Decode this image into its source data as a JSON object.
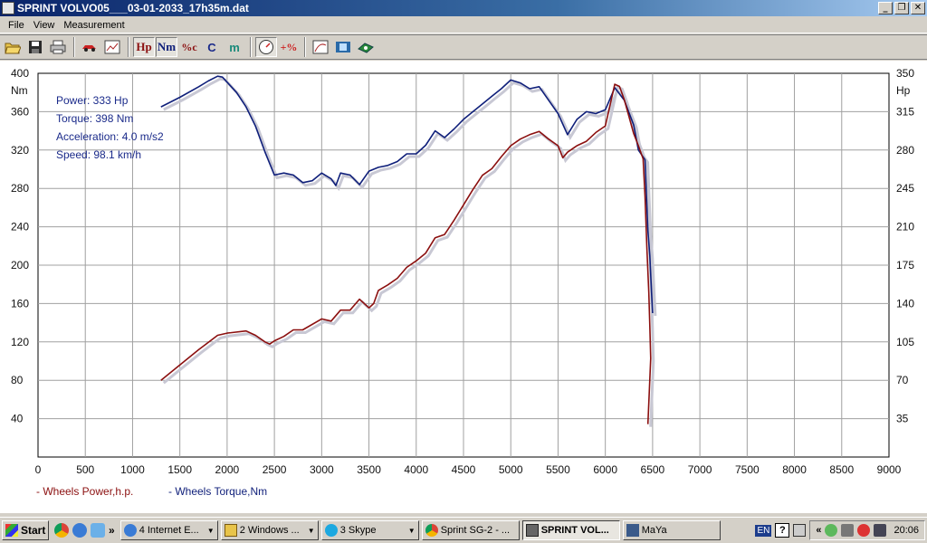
{
  "window": {
    "title": "SPRINT VOLVO05___03-01-2033_17h35m.dat",
    "min": "_",
    "max": "❐",
    "close": "✕"
  },
  "menu": [
    {
      "label": "File"
    },
    {
      "label": "View"
    },
    {
      "label": "Measurement"
    }
  ],
  "toolbar": {
    "hp": "Hp",
    "nm": "Nm",
    "pct": "%c",
    "c": "C",
    "m": "m",
    "plus_pct": "+%"
  },
  "info": {
    "power": "Power: 333 Hp",
    "torque": "Torque: 398 Nm",
    "acceleration": "Acceleration: 4.0 m/s2",
    "speed": "Speed: 98.1 km/h"
  },
  "legend": {
    "power": "- Wheels Power,h.p.",
    "torque": "- Wheels Torque,Nm"
  },
  "colors": {
    "power": "#8b0f0f",
    "torque": "#0f1f7a",
    "info": "#1a2a8a",
    "shadow": "#c8c8d4"
  },
  "chart_data": {
    "type": "line",
    "xlim": [
      0,
      9000
    ],
    "x_ticks": [
      "0",
      "500",
      "1000",
      "1500",
      "2000",
      "2500",
      "3000",
      "3500",
      "4000",
      "4500",
      "5000",
      "5500",
      "6000",
      "6500",
      "7000",
      "7500",
      "8000",
      "8500",
      "9000"
    ],
    "ylim_left": [
      0,
      400
    ],
    "y_left_unit": "Nm",
    "y_left_ticks": [
      "400",
      "360",
      "320",
      "280",
      "240",
      "200",
      "160",
      "120",
      "80",
      "40"
    ],
    "ylim_right": [
      0,
      350
    ],
    "y_right_unit": "Hp",
    "y_right_ticks": [
      "350",
      "315",
      "280",
      "245",
      "210",
      "175",
      "140",
      "105",
      "70",
      "35"
    ],
    "series": [
      {
        "name": "Wheels Torque,Nm",
        "axis": "left",
        "points": [
          [
            1300,
            365
          ],
          [
            1500,
            375
          ],
          [
            1700,
            386
          ],
          [
            1800,
            392
          ],
          [
            1900,
            397
          ],
          [
            1950,
            396
          ],
          [
            2100,
            380
          ],
          [
            2200,
            365
          ],
          [
            2300,
            345
          ],
          [
            2400,
            318
          ],
          [
            2500,
            294
          ],
          [
            2600,
            296
          ],
          [
            2700,
            294
          ],
          [
            2800,
            286
          ],
          [
            2900,
            288
          ],
          [
            3000,
            296
          ],
          [
            3100,
            290
          ],
          [
            3150,
            283
          ],
          [
            3200,
            296
          ],
          [
            3300,
            294
          ],
          [
            3400,
            284
          ],
          [
            3500,
            298
          ],
          [
            3600,
            302
          ],
          [
            3700,
            304
          ],
          [
            3800,
            308
          ],
          [
            3900,
            316
          ],
          [
            4000,
            316
          ],
          [
            4100,
            325
          ],
          [
            4200,
            340
          ],
          [
            4300,
            333
          ],
          [
            4400,
            342
          ],
          [
            4500,
            352
          ],
          [
            4600,
            360
          ],
          [
            4700,
            368
          ],
          [
            4800,
            376
          ],
          [
            4900,
            384
          ],
          [
            5000,
            393
          ],
          [
            5100,
            390
          ],
          [
            5200,
            384
          ],
          [
            5300,
            386
          ],
          [
            5400,
            372
          ],
          [
            5500,
            358
          ],
          [
            5600,
            336
          ],
          [
            5700,
            352
          ],
          [
            5800,
            360
          ],
          [
            5900,
            358
          ],
          [
            6000,
            362
          ],
          [
            6100,
            385
          ],
          [
            6200,
            372
          ],
          [
            6300,
            346
          ],
          [
            6350,
            320
          ],
          [
            6420,
            310
          ],
          [
            6450,
            236
          ],
          [
            6470,
            210
          ],
          [
            6490,
            170
          ],
          [
            6500,
            150
          ]
        ]
      },
      {
        "name": "Wheels Power,h.p.",
        "axis": "right",
        "points": [
          [
            1300,
            70
          ],
          [
            1500,
            84
          ],
          [
            1700,
            98
          ],
          [
            1900,
            111
          ],
          [
            2000,
            113
          ],
          [
            2200,
            115
          ],
          [
            2300,
            111
          ],
          [
            2400,
            105
          ],
          [
            2450,
            103
          ],
          [
            2500,
            106
          ],
          [
            2600,
            110
          ],
          [
            2700,
            116
          ],
          [
            2800,
            116
          ],
          [
            3000,
            126
          ],
          [
            3100,
            124
          ],
          [
            3200,
            134
          ],
          [
            3300,
            134
          ],
          [
            3400,
            144
          ],
          [
            3500,
            136
          ],
          [
            3550,
            140
          ],
          [
            3600,
            152
          ],
          [
            3700,
            157
          ],
          [
            3800,
            163
          ],
          [
            3900,
            173
          ],
          [
            4000,
            179
          ],
          [
            4100,
            186
          ],
          [
            4200,
            200
          ],
          [
            4300,
            203
          ],
          [
            4400,
            216
          ],
          [
            4500,
            230
          ],
          [
            4600,
            244
          ],
          [
            4700,
            257
          ],
          [
            4800,
            263
          ],
          [
            4900,
            274
          ],
          [
            5000,
            284
          ],
          [
            5100,
            290
          ],
          [
            5200,
            294
          ],
          [
            5300,
            297
          ],
          [
            5400,
            290
          ],
          [
            5500,
            284
          ],
          [
            5550,
            273
          ],
          [
            5600,
            278
          ],
          [
            5700,
            284
          ],
          [
            5800,
            288
          ],
          [
            5900,
            296
          ],
          [
            6000,
            302
          ],
          [
            6100,
            340
          ],
          [
            6150,
            338
          ],
          [
            6200,
            326
          ],
          [
            6300,
            295
          ],
          [
            6350,
            284
          ],
          [
            6400,
            272
          ],
          [
            6420,
            238
          ],
          [
            6440,
            190
          ],
          [
            6460,
            150
          ],
          [
            6470,
            120
          ],
          [
            6480,
            90
          ],
          [
            6450,
            30
          ]
        ]
      }
    ]
  },
  "taskbar": {
    "start": "Start",
    "more": "»",
    "items": [
      {
        "label": "4 Internet E...",
        "icon": "ie-icon"
      },
      {
        "label": "2 Windows ...",
        "icon": "folder-icon"
      },
      {
        "label": "3 Skype",
        "icon": "skype-icon"
      },
      {
        "label": "Sprint SG-2 - ...",
        "icon": "chrome-icon"
      },
      {
        "label": "SPRINT VOL...",
        "icon": "sprint-icon",
        "active": true
      },
      {
        "label": "MaYa",
        "icon": "maya-icon"
      }
    ],
    "lang": "EN",
    "help": "?",
    "tray_more": "«",
    "clock": "20:06"
  }
}
